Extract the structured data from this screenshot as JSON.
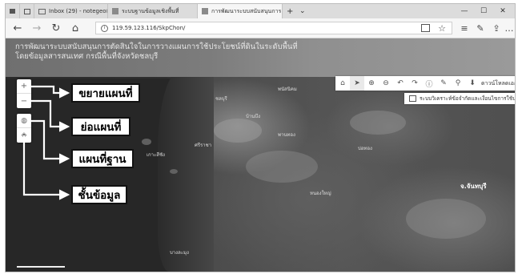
{
  "browser": {
    "tabs": [
      {
        "label": "Inbox (29) - notegeo@gmai",
        "icon": "gmail-icon",
        "active": false
      },
      {
        "label": "ระบบฐานข้อมูลเชิงพื้นที่",
        "icon": "page-icon",
        "active": false
      },
      {
        "label": "การพัฒนาระบบสนับสนุนการ",
        "icon": "page-icon",
        "active": true
      }
    ],
    "new_tab_symbol": "+",
    "tab_list_symbol": "⌄",
    "window_controls": {
      "minimize": "—",
      "maximize": "☐",
      "close": "✕"
    },
    "address": {
      "url": "119.59.123.116/SkpChon/",
      "security_icon": "info-icon"
    },
    "nav_icons": [
      "back-icon",
      "forward-icon",
      "refresh-icon",
      "home-icon"
    ],
    "right_icons": [
      "reading-view-icon",
      "favorite-star-icon",
      "favorites-list-icon",
      "pen-icon",
      "share-icon",
      "more-icon"
    ],
    "more_symbol": "…"
  },
  "site": {
    "title_line1": "การพัฒนาระบบสนับสนุนการตัดสินใจในการวางแผนการใช้ประโยชน์ที่ดินในระดับพื้นที่",
    "title_line2": "โดยข้อมูลสารสนเทศ กรณีพื้นที่จังหวัดชลบุรี"
  },
  "map_toolbar": {
    "buttons": [
      "home-icon",
      "locate-icon",
      "zoom-in-icon",
      "zoom-out-icon",
      "undo-icon",
      "redo-icon",
      "info-icon",
      "draw-icon",
      "pin-icon",
      "download-icon"
    ],
    "download_label": "ดาวน์โหลดเอกสาร"
  },
  "map_link": {
    "icon": "book-icon",
    "label": "ระบบวิเคราะห์ข้อจำกัดและเงื่อนไขการใช้ประโยชน์"
  },
  "zoom_controls": {
    "zoom_in": "+",
    "zoom_out": "−"
  },
  "layer_controls": {
    "basemap_icon": "globe-icon",
    "layers_icon": "layers-icon"
  },
  "callouts": {
    "zoom_in": "ขยายแผนที่",
    "zoom_out": "ย่อแผนที่",
    "basemap": "แผนที่ฐาน",
    "layers": "ชั้นข้อมูล"
  },
  "place_labels": [
    {
      "label": "ชลบุรี"
    },
    {
      "label": "พนัสนิคม"
    },
    {
      "label": "บ้านบึง"
    },
    {
      "label": "ศรีราชา"
    },
    {
      "label": "บ่อทอง"
    },
    {
      "label": "หนองใหญ่"
    },
    {
      "label": "เกาะสีชัง"
    },
    {
      "label": "บางละมุง"
    },
    {
      "label": "พานทอง"
    },
    {
      "label": "จ.จันทบุรี"
    }
  ]
}
